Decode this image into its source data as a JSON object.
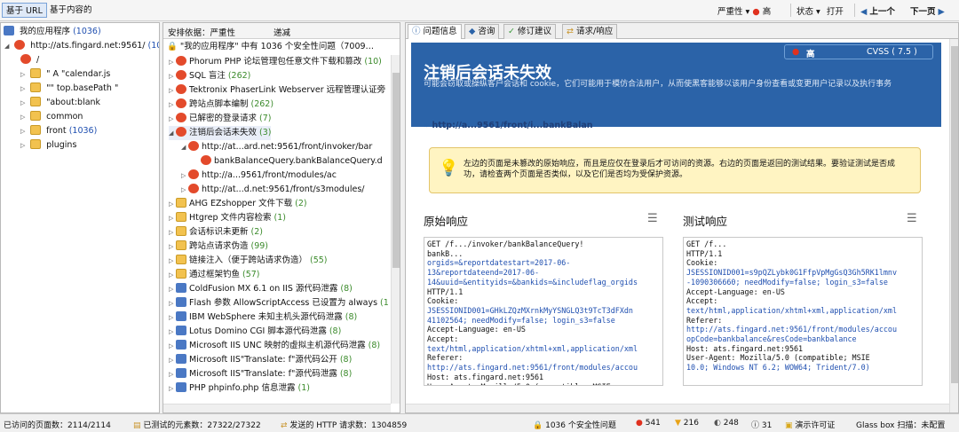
{
  "topbar": {
    "tab_url": "基于 URL",
    "tab_content": "基于内容的",
    "severity_label": "严重性",
    "severity_value": "高",
    "status_label": "状态",
    "status_value": "打开",
    "prev": "上一个",
    "next": "下一页"
  },
  "left": {
    "items": [
      {
        "label": "我的应用程序",
        "count": "(1036)"
      },
      {
        "label": "http://ats.fingard.net:9561/",
        "count": "(103"
      },
      {
        "label": "/"
      },
      {
        "label": "\" A \"calendar.js"
      },
      {
        "label": "\"\" top.basePath \""
      },
      {
        "label": "\"about:blank"
      },
      {
        "label": "common"
      },
      {
        "label": "front",
        "count": "(1036)"
      },
      {
        "label": "plugins"
      }
    ]
  },
  "middle": {
    "col1": "安排依据：严重性",
    "col2": "递减",
    "summary": "\"我的应用程序\" 中有  1036  个安全性问题（7009…",
    "items": [
      {
        "label": "Phorum PHP 论坛管理包任意文件下载和篡改",
        "count": "(10)"
      },
      {
        "label": "SQL 盲注",
        "count": "(262)"
      },
      {
        "label": "Tektronix PhaserLink Webserver 远程管理认证旁",
        "count": ""
      },
      {
        "label": "跨站点脚本编制",
        "count": "(262)"
      },
      {
        "label": "已解密的登录请求",
        "count": "(7)"
      },
      {
        "label": "注销后会话未失效",
        "count": "(3)"
      },
      {
        "label": "http://at...ard.net:9561/front/invoker/bar",
        "count": ""
      },
      {
        "label": "bankBalanceQuery.bankBalanceQuery.d",
        "count": ""
      },
      {
        "label": "http://a...9561/front/modules/ac",
        "count": ""
      },
      {
        "label": "http://at...d.net:9561/front/s3modules/",
        "count": ""
      },
      {
        "label": "AHG EZshopper 文件下载",
        "count": "(2)"
      },
      {
        "label": "Htgrep 文件内容检索",
        "count": "(1)"
      },
      {
        "label": "会话标识未更新",
        "count": "(2)"
      },
      {
        "label": "跨站点请求伪造",
        "count": "(99)"
      },
      {
        "label": "链接注入（便于跨站请求伪造）",
        "count": "(55)"
      },
      {
        "label": "通过框架钓鱼",
        "count": "(57)"
      },
      {
        "label": "ColdFusion MX 6.1 on IIS 源代码泄露",
        "count": "(8)"
      },
      {
        "label": "Flash 参数 AllowScriptAccess 已设置为 always",
        "count": "(1"
      },
      {
        "label": "IBM WebSphere 未知主机头源代码泄露",
        "count": "(8)"
      },
      {
        "label": "Lotus Domino CGI 脚本源代码泄露",
        "count": "(8)"
      },
      {
        "label": "Microsoft IIS UNC 映射的虚拟主机源代码泄露",
        "count": "(8)"
      },
      {
        "label": "Microsoft IIS\"Translate: f\"源代码公开",
        "count": "(8)"
      },
      {
        "label": "Microsoft IIS\"Translate: f\"源代码泄露",
        "count": "(8)"
      },
      {
        "label": "PHP phpinfo.php 信息泄露",
        "count": "(1)"
      }
    ]
  },
  "right": {
    "tabs": [
      "问题信息",
      "咨询",
      "修订建议",
      "请求/响应"
    ],
    "severity_badge": "高",
    "cvss": "CVSS  ( 7.5 )",
    "title": "注销后会话未失效",
    "desc": "可能会窃取或操纵客户会话和 cookie，它们可能用于模仿合法用户，从而使黑客能够以该用户身份查看或变更用户记录以及执行事务",
    "url": "http://a...9561/front/i...bankBalan",
    "info": "左边的页面是未篡改的原始响应，而且是应仅在登录后才可访问的资源。右边的页面是返回的测试结果。要验证测试是否成功，请检查两个页面是否类似，以及它们是否均为受保护资源。",
    "orig_title": "原始响应",
    "test_title": "测试响应",
    "orig_code": [
      "GET /f.../invoker/bankBalanceQuery!",
      "bankB...",
      "orgids=&reportdatestart=2017-06-",
      "13&reportdateend=2017-06-",
      "14&uuid=&entityids=&bankids=&includeflag_orgids",
      "HTTP/1.1",
      "Cookie:",
      "JSESSIONID001=GHkLZQzMXrnkMyYSNGLQ3t9TcT3dFXdn",
      "41102564; needModify=false; login_s3=false",
      "Accept-Language: en-US",
      "Accept:",
      "text/html,application/xhtml+xml,application/xml",
      "Referer:",
      "http://ats.fingard.net:9561/front/modules/accou",
      "Host: ats.fingard.net:9561",
      "User-Agent: Mozilla/5.0 (compatible; MSIE"
    ],
    "test_code": [
      "GET /f...",
      "HTTP/1.1",
      "Cookie:",
      "JSESSIONID001=s9pQZLybk0G1FfpVpMgGsQ3Gh5RK1lmnv",
      "-1090306660; needModify=false; login_s3=false",
      "Accept-Language: en-US",
      "Accept:",
      "text/html,application/xhtml+xml,application/xml",
      "Referer:",
      "http://ats.fingard.net:9561/front/modules/accou",
      "opCode=bankbalance&resCode=bankbalance",
      "Host: ats.fingard.net:9561",
      "User-Agent: Mozilla/5.0 (compatible; MSIE",
      "10.0; Windows NT 6.2; WOW64; Trident/7.0)"
    ]
  },
  "status": {
    "visited": "已访问的页面数：2114/2114",
    "tested": "已测试的元素数：27322/27322",
    "sent": "发送的 HTTP 请求数：1304859",
    "issues": "1036 个安全性问题",
    "high": "541",
    "medium": "216",
    "low": "248",
    "info": "31",
    "license": "演示许可证",
    "scan": "Glass box 扫描：未配置"
  },
  "colors": {
    "accent": "#2b63a8",
    "high": "#e0311f",
    "info_bg": "#fff4c2"
  }
}
